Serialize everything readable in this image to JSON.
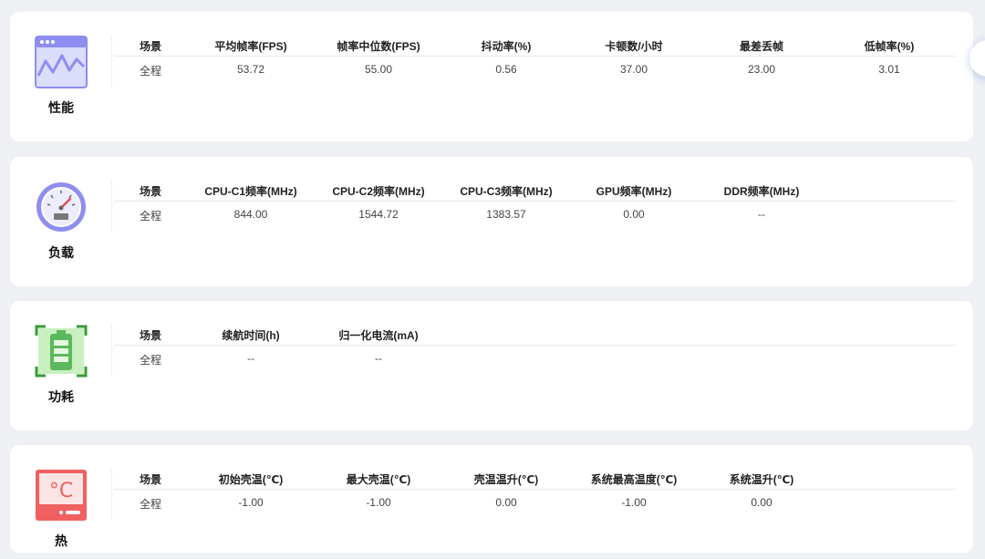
{
  "colors": {
    "performance": "#8e8ef0",
    "load": "#8e8ef0",
    "power": "#5cb85c",
    "thermal": "#f06060"
  },
  "sections": [
    {
      "label": "性能",
      "icon": "performance-chart-icon",
      "headers": [
        "场景",
        "平均帧率(FPS)",
        "帧率中位数(FPS)",
        "抖动率(%)",
        "卡顿数/小时",
        "最差丢帧",
        "低帧率(%)"
      ],
      "rows": [
        [
          "全程",
          "53.72",
          "55.00",
          "0.56",
          "37.00",
          "23.00",
          "3.01"
        ]
      ]
    },
    {
      "label": "负载",
      "icon": "gauge-icon",
      "headers": [
        "场景",
        "CPU-C1频率(MHz)",
        "CPU-C2频率(MHz)",
        "CPU-C3频率(MHz)",
        "GPU频率(MHz)",
        "DDR频率(MHz)"
      ],
      "rows": [
        [
          "全程",
          "844.00",
          "1544.72",
          "1383.57",
          "0.00",
          "--"
        ]
      ]
    },
    {
      "label": "功耗",
      "icon": "battery-icon",
      "headers": [
        "场景",
        "续航时间(h)",
        "归一化电流(mA)"
      ],
      "rows": [
        [
          "全程",
          "--",
          "--"
        ]
      ]
    },
    {
      "label": "热",
      "icon": "thermometer-celsius-icon",
      "icon_text": "°C",
      "headers": [
        "场景",
        "初始壳温(℃)",
        "最大壳温(℃)",
        "壳温温升(℃)",
        "系统最高温度(℃)",
        "系统温升(℃)"
      ],
      "rows": [
        [
          "全程",
          "-1.00",
          "-1.00",
          "0.00",
          "-1.00",
          "0.00"
        ]
      ]
    }
  ]
}
